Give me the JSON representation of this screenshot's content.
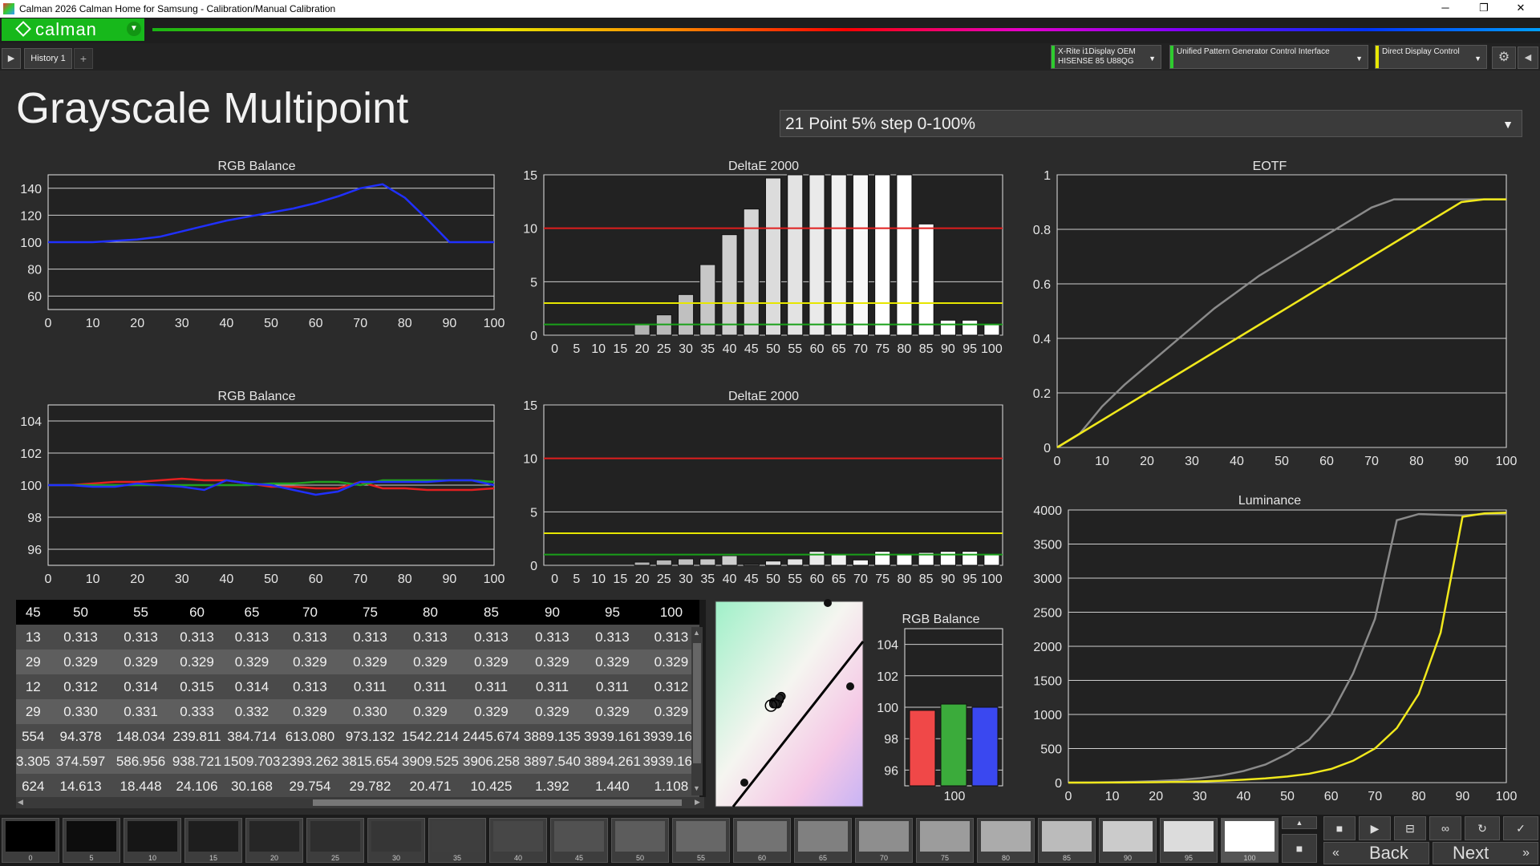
{
  "window": {
    "title": "Calman 2026 Calman Home for Samsung  - Calibration/Manual Calibration",
    "minimize": "─",
    "maximize": "❐",
    "close": "✕"
  },
  "app": {
    "logo": "calman",
    "history_tab": "History 1",
    "add_tab": "+"
  },
  "devices": [
    {
      "line1": "X-Rite i1Display OEM",
      "line2": "HISENSE 85 U88QG",
      "color": "#2ecc2e"
    },
    {
      "line1": "Unified Pattern Generator Control Interface",
      "line2": "",
      "color": "#2ecc2e"
    },
    {
      "line1": "Direct Display Control",
      "line2": "",
      "color": "#e6e600"
    }
  ],
  "page": {
    "title": "Grayscale Multipoint",
    "preset": "21 Point 5% step 0-100%"
  },
  "charts": {
    "rgb1_title": "RGB Balance",
    "de1_title": "DeltaE 2000",
    "eotf_title": "EOTF",
    "rgb2_title": "RGB Balance",
    "de2_title": "DeltaE 2000",
    "lum_title": "Luminance",
    "rgbbar_title": "RGB Balance",
    "rgbbar_xlabel": "100"
  },
  "chart_data": [
    {
      "type": "line",
      "title": "RGB Balance",
      "x": [
        0,
        5,
        10,
        15,
        20,
        25,
        30,
        35,
        40,
        45,
        50,
        55,
        60,
        65,
        70,
        75,
        80,
        85,
        90,
        95,
        100
      ],
      "series": [
        {
          "color": "#2030ff",
          "values": [
            100,
            100,
            100,
            101,
            102,
            104,
            108,
            112,
            116,
            119,
            122,
            125,
            129,
            134,
            140,
            143,
            133,
            117,
            100,
            100,
            100
          ]
        }
      ],
      "ylim": [
        50,
        150
      ],
      "yticks": [
        60,
        80,
        100,
        120,
        140
      ],
      "xticks": [
        0,
        10,
        20,
        30,
        40,
        50,
        60,
        70,
        80,
        90,
        100
      ]
    },
    {
      "type": "bar",
      "title": "DeltaE 2000",
      "categories": [
        0,
        5,
        10,
        15,
        20,
        25,
        30,
        35,
        40,
        45,
        50,
        55,
        60,
        65,
        70,
        75,
        80,
        85,
        90,
        95,
        100
      ],
      "values": [
        0,
        0,
        0,
        0,
        1.0,
        1.9,
        3.8,
        6.6,
        9.4,
        11.8,
        14.7,
        15,
        15,
        15,
        15,
        15,
        15,
        10.4,
        1.4,
        1.4,
        1.1
      ],
      "ylim": [
        0,
        15
      ],
      "yticks": [
        0,
        5,
        10,
        15
      ],
      "reference_lines": [
        {
          "y": 10,
          "color": "#e01e1e"
        },
        {
          "y": 3,
          "color": "#e6e600"
        },
        {
          "y": 1,
          "color": "#1aa01a"
        }
      ]
    },
    {
      "type": "line",
      "title": "EOTF",
      "x": [
        0,
        5,
        10,
        15,
        20,
        25,
        30,
        35,
        40,
        45,
        50,
        55,
        60,
        65,
        70,
        75,
        80,
        85,
        90,
        95,
        100
      ],
      "series": [
        {
          "color": "#8a8a8a",
          "values": [
            0,
            0.05,
            0.15,
            0.23,
            0.3,
            0.37,
            0.44,
            0.51,
            0.57,
            0.63,
            0.68,
            0.73,
            0.78,
            0.83,
            0.88,
            0.91,
            0.91,
            0.91,
            0.91,
            0.91,
            0.91
          ]
        },
        {
          "color": "#f0e81c",
          "values": [
            0,
            0.05,
            0.1,
            0.15,
            0.2,
            0.25,
            0.3,
            0.35,
            0.4,
            0.45,
            0.5,
            0.55,
            0.6,
            0.65,
            0.7,
            0.75,
            0.8,
            0.85,
            0.9,
            0.91,
            0.91
          ]
        }
      ],
      "ylim": [
        0,
        1
      ],
      "yticks": [
        0,
        0.2,
        0.4,
        0.6,
        0.8,
        1
      ],
      "xticks": [
        0,
        10,
        20,
        30,
        40,
        50,
        60,
        70,
        80,
        90,
        100
      ]
    },
    {
      "type": "line",
      "title": "RGB Balance",
      "x": [
        0,
        5,
        10,
        15,
        20,
        25,
        30,
        35,
        40,
        45,
        50,
        55,
        60,
        65,
        70,
        75,
        80,
        85,
        90,
        95,
        100
      ],
      "series": [
        {
          "color": "#e52020",
          "values": [
            100,
            100,
            100.1,
            100.2,
            100.2,
            100.3,
            100.4,
            100.3,
            100.3,
            100.1,
            99.9,
            99.9,
            99.8,
            99.8,
            100.2,
            99.8,
            99.8,
            99.7,
            99.7,
            99.7,
            99.8
          ]
        },
        {
          "color": "#20a020",
          "values": [
            100,
            100,
            100,
            100,
            100,
            100,
            100,
            100,
            100,
            100,
            100.1,
            100.1,
            100.2,
            100.2,
            100,
            100.3,
            100.3,
            100.3,
            100.3,
            100.3,
            100.2
          ]
        },
        {
          "color": "#2030ff",
          "values": [
            100,
            100,
            99.9,
            99.9,
            100.1,
            100,
            99.9,
            99.7,
            100.3,
            100.1,
            100,
            99.7,
            99.4,
            99.6,
            100.2,
            100.2,
            100.2,
            100.2,
            100.3,
            100.3,
            100
          ]
        }
      ],
      "ylim": [
        95,
        105
      ],
      "yticks": [
        96,
        98,
        100,
        102,
        104
      ],
      "xticks": [
        0,
        10,
        20,
        30,
        40,
        50,
        60,
        70,
        80,
        90,
        100
      ]
    },
    {
      "type": "bar",
      "title": "DeltaE 2000",
      "categories": [
        0,
        5,
        10,
        15,
        20,
        25,
        30,
        35,
        40,
        45,
        50,
        55,
        60,
        65,
        70,
        75,
        80,
        85,
        90,
        95,
        100
      ],
      "values": [
        0,
        0,
        0,
        0,
        0.3,
        0.5,
        0.6,
        0.6,
        0.9,
        0.1,
        0.4,
        0.6,
        1.3,
        1.0,
        0.5,
        1.3,
        1.0,
        1.2,
        1.3,
        1.3,
        1.0
      ],
      "ylim": [
        0,
        15
      ],
      "yticks": [
        0,
        5,
        10,
        15
      ],
      "reference_lines": [
        {
          "y": 10,
          "color": "#e01e1e"
        },
        {
          "y": 3,
          "color": "#e6e600"
        },
        {
          "y": 1,
          "color": "#1aa01a"
        }
      ]
    },
    {
      "type": "line",
      "title": "Luminance",
      "x": [
        0,
        5,
        10,
        15,
        20,
        25,
        30,
        35,
        40,
        45,
        50,
        55,
        60,
        65,
        70,
        75,
        80,
        85,
        90,
        95,
        100
      ],
      "series": [
        {
          "color": "#8a8a8a",
          "values": [
            0,
            2,
            6,
            12,
            22,
            38,
            65,
            105,
            170,
            265,
            420,
            630,
            1000,
            1600,
            2400,
            3850,
            3940,
            3930,
            3920,
            3940,
            3940
          ]
        },
        {
          "color": "#f0e81c",
          "values": [
            0,
            0,
            1,
            3,
            6,
            11,
            18,
            28,
            42,
            62,
            90,
            130,
            200,
            320,
            500,
            800,
            1300,
            2200,
            3900,
            3950,
            3960
          ]
        }
      ],
      "ylim": [
        0,
        4000
      ],
      "yticks": [
        0,
        500,
        1000,
        1500,
        2000,
        2500,
        3000,
        3500,
        4000
      ],
      "xticks": [
        0,
        10,
        20,
        30,
        40,
        50,
        60,
        70,
        80,
        90,
        100
      ]
    },
    {
      "type": "scatter",
      "title": "",
      "points": [
        [
          0.313,
          0.329
        ],
        [
          0.312,
          0.33
        ],
        [
          0.314,
          0.331
        ],
        [
          0.315,
          0.333
        ],
        [
          0.314,
          0.332
        ],
        [
          0.311,
          0.33
        ],
        [
          0.311,
          0.329
        ],
        [
          0.313,
          0.329
        ],
        [
          0.312,
          0.329
        ]
      ]
    },
    {
      "type": "bar",
      "title": "RGB Balance",
      "categories": [
        "100"
      ],
      "series": [
        {
          "name": "R",
          "color": "#f04848",
          "values": [
            99.8
          ]
        },
        {
          "name": "G",
          "color": "#3bab3b",
          "values": [
            100.2
          ]
        },
        {
          "name": "B",
          "color": "#3a48f0",
          "values": [
            100
          ]
        }
      ],
      "ylim": [
        95,
        105
      ],
      "yticks": [
        96,
        98,
        100,
        102,
        104
      ]
    }
  ],
  "table": {
    "header": [
      "45",
      "50",
      "55",
      "60",
      "65",
      "70",
      "75",
      "80",
      "85",
      "90",
      "95",
      "100"
    ],
    "rows": [
      [
        "13",
        "0.313",
        "0.313",
        "0.313",
        "0.313",
        "0.313",
        "0.313",
        "0.313",
        "0.313",
        "0.313",
        "0.313",
        "0.313"
      ],
      [
        "29",
        "0.329",
        "0.329",
        "0.329",
        "0.329",
        "0.329",
        "0.329",
        "0.329",
        "0.329",
        "0.329",
        "0.329",
        "0.329"
      ],
      [
        "12",
        "0.312",
        "0.314",
        "0.315",
        "0.314",
        "0.313",
        "0.311",
        "0.311",
        "0.311",
        "0.311",
        "0.311",
        "0.312"
      ],
      [
        "29",
        "0.330",
        "0.331",
        "0.333",
        "0.332",
        "0.329",
        "0.330",
        "0.329",
        "0.329",
        "0.329",
        "0.329",
        "0.329"
      ],
      [
        "554",
        "94.378",
        "148.034",
        "239.811",
        "384.714",
        "613.080",
        "973.132",
        "1542.214",
        "2445.674",
        "3889.135",
        "3939.161",
        "3939.161"
      ],
      [
        "3.305",
        "374.597",
        "586.956",
        "938.721",
        "1509.703",
        "2393.262",
        "3815.654",
        "3909.525",
        "3906.258",
        "3897.540",
        "3894.261",
        "3939.161"
      ],
      [
        "624",
        "14.613",
        "18.448",
        "24.106",
        "30.168",
        "29.754",
        "29.782",
        "20.471",
        "10.425",
        "1.392",
        "1.440",
        "1.108"
      ]
    ]
  },
  "swatches": [
    {
      "label": "0",
      "color": "#000000"
    },
    {
      "label": "5",
      "color": "#0d0d0d"
    },
    {
      "label": "10",
      "color": "#161616"
    },
    {
      "label": "15",
      "color": "#1e1e1e"
    },
    {
      "label": "20",
      "color": "#262626"
    },
    {
      "label": "25",
      "color": "#2e2e2e"
    },
    {
      "label": "30",
      "color": "#363636"
    },
    {
      "label": "35",
      "color": "#3e3e3e"
    },
    {
      "label": "40",
      "color": "#474747"
    },
    {
      "label": "45",
      "color": "#515151"
    },
    {
      "label": "50",
      "color": "#5c5c5c"
    },
    {
      "label": "55",
      "color": "#676767"
    },
    {
      "label": "60",
      "color": "#737373"
    },
    {
      "label": "65",
      "color": "#808080"
    },
    {
      "label": "70",
      "color": "#8e8e8e"
    },
    {
      "label": "75",
      "color": "#9c9c9c"
    },
    {
      "label": "80",
      "color": "#ababab"
    },
    {
      "label": "85",
      "color": "#bbbbbb"
    },
    {
      "label": "90",
      "color": "#cbcbcb"
    },
    {
      "label": "95",
      "color": "#dcdcdc"
    },
    {
      "label": "100",
      "color": "#ffffff"
    }
  ],
  "nav": {
    "back": "Back",
    "next": "Next"
  }
}
